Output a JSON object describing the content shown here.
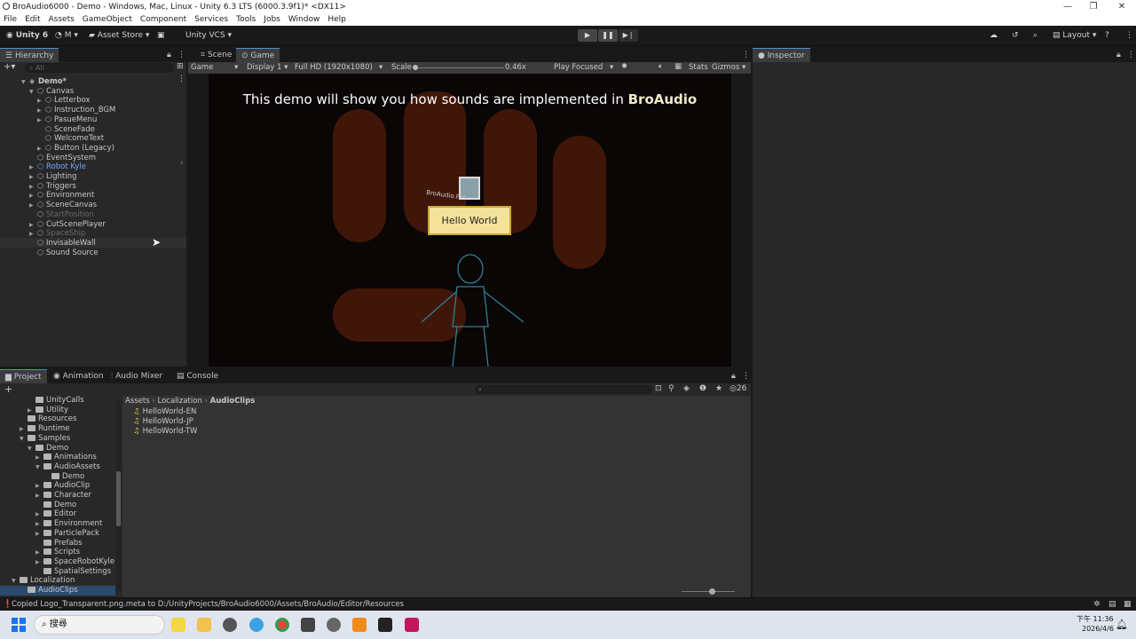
{
  "window": {
    "title": "BroAudio6000 - Demo - Windows, Mac, Linux - Unity 6.3 LTS (6000.3.9f1)* <DX11>"
  },
  "menu": [
    "File",
    "Edit",
    "Assets",
    "GameObject",
    "Component",
    "Services",
    "Tools",
    "Jobs",
    "Window",
    "Help"
  ],
  "toolbar": {
    "unity_label": "Unity 6",
    "account_label": "M",
    "asset_store": "Asset Store",
    "vcs": "Unity VCS",
    "layout": "Layout"
  },
  "hierarchy": {
    "tab": "Hierarchy",
    "search_placeholder": "All",
    "items": [
      {
        "label": "Demo*",
        "depth": 0,
        "arrow": "▼",
        "state": "scene"
      },
      {
        "label": "Canvas",
        "depth": 1,
        "arrow": "▼",
        "state": "normal"
      },
      {
        "label": "Letterbox",
        "depth": 2,
        "arrow": "▶",
        "state": "normal"
      },
      {
        "label": "Instruction_BGM",
        "depth": 2,
        "arrow": "▶",
        "state": "normal"
      },
      {
        "label": "PasueMenu",
        "depth": 2,
        "arrow": "▶",
        "state": "normal"
      },
      {
        "label": "SceneFade",
        "depth": 2,
        "arrow": "",
        "state": "normal"
      },
      {
        "label": "WelcomeText",
        "depth": 2,
        "arrow": "",
        "state": "normal"
      },
      {
        "label": "Button (Legacy)",
        "depth": 2,
        "arrow": "▶",
        "state": "normal"
      },
      {
        "label": "EventSystem",
        "depth": 1,
        "arrow": "",
        "state": "normal"
      },
      {
        "label": "Robot Kyle",
        "depth": 1,
        "arrow": "▶",
        "state": "prefab"
      },
      {
        "label": "Lighting",
        "depth": 1,
        "arrow": "▶",
        "state": "normal"
      },
      {
        "label": "Triggers",
        "depth": 1,
        "arrow": "▶",
        "state": "normal"
      },
      {
        "label": "Environment",
        "depth": 1,
        "arrow": "▶",
        "state": "normal"
      },
      {
        "label": "SceneCanvas",
        "depth": 1,
        "arrow": "▶",
        "state": "normal"
      },
      {
        "label": "StartPosition",
        "depth": 1,
        "arrow": "",
        "state": "disabled"
      },
      {
        "label": "CutScenePlayer",
        "depth": 1,
        "arrow": "▶",
        "state": "normal"
      },
      {
        "label": "SpaceShip",
        "depth": 1,
        "arrow": "▶",
        "state": "disabled"
      },
      {
        "label": "InvisableWall",
        "depth": 1,
        "arrow": "",
        "state": "hover"
      },
      {
        "label": "Sound Source",
        "depth": 1,
        "arrow": "",
        "state": "normal"
      }
    ]
  },
  "scene_tabs": {
    "scene": "Scene",
    "game": "Game"
  },
  "game_toolbar": {
    "mode": "Game",
    "display": "Display 1",
    "resolution": "Full HD (1920x1080)",
    "scale_label": "Scale",
    "scale_value": "0.46x",
    "play_mode": "Play Focused",
    "stats": "Stats",
    "gizmos": "Gizmos"
  },
  "game_view": {
    "headline": "This demo will show you how sounds are implemented in ",
    "headline_bold": "BroAudio",
    "button": "Hello World",
    "sign": "BroAudio.Pet"
  },
  "inspector": {
    "tab": "Inspector"
  },
  "bottom_tabs": {
    "project": "Project",
    "animation": "Animation",
    "audio_mixer": "Audio Mixer",
    "console": "Console"
  },
  "project": {
    "count": "26",
    "breadcrumb": [
      "Assets",
      "Localization",
      "AudioClips"
    ],
    "tree": [
      {
        "label": "UnityCalls",
        "depth": 3,
        "arrow": ""
      },
      {
        "label": "Utility",
        "depth": 3,
        "arrow": "▶"
      },
      {
        "label": "Resources",
        "depth": 2,
        "arrow": ""
      },
      {
        "label": "Runtime",
        "depth": 2,
        "arrow": "▶"
      },
      {
        "label": "Samples",
        "depth": 2,
        "arrow": "▼"
      },
      {
        "label": "Demo",
        "depth": 3,
        "arrow": "▼"
      },
      {
        "label": "Animations",
        "depth": 4,
        "arrow": "▶"
      },
      {
        "label": "AudioAssets",
        "depth": 4,
        "arrow": "▼"
      },
      {
        "label": "Demo",
        "depth": 5,
        "arrow": ""
      },
      {
        "label": "AudioClip",
        "depth": 4,
        "arrow": "▶"
      },
      {
        "label": "Character",
        "depth": 4,
        "arrow": "▶"
      },
      {
        "label": "Demo",
        "depth": 4,
        "arrow": ""
      },
      {
        "label": "Editor",
        "depth": 4,
        "arrow": "▶"
      },
      {
        "label": "Environment",
        "depth": 4,
        "arrow": "▶"
      },
      {
        "label": "ParticlePack",
        "depth": 4,
        "arrow": "▶"
      },
      {
        "label": "Prefabs",
        "depth": 4,
        "arrow": ""
      },
      {
        "label": "Scripts",
        "depth": 4,
        "arrow": "▶"
      },
      {
        "label": "SpaceRobotKyle",
        "depth": 4,
        "arrow": "▶"
      },
      {
        "label": "SpatialSettings",
        "depth": 4,
        "arrow": ""
      },
      {
        "label": "Localization",
        "depth": 1,
        "arrow": "▼"
      },
      {
        "label": "AudioClips",
        "depth": 2,
        "arrow": ""
      }
    ],
    "files": [
      "HelloWorld-EN",
      "HelloWorld-JP",
      "HelloWorld-TW"
    ]
  },
  "status": {
    "message": "Copied Logo_Transparent.png.meta to D:/UnityProjects/BroAudio6000/Assets/BroAudio/Editor/Resources"
  },
  "taskbar": {
    "search_placeholder": "搜尋",
    "time": "下午 11:36",
    "date": "2026/4/6"
  }
}
